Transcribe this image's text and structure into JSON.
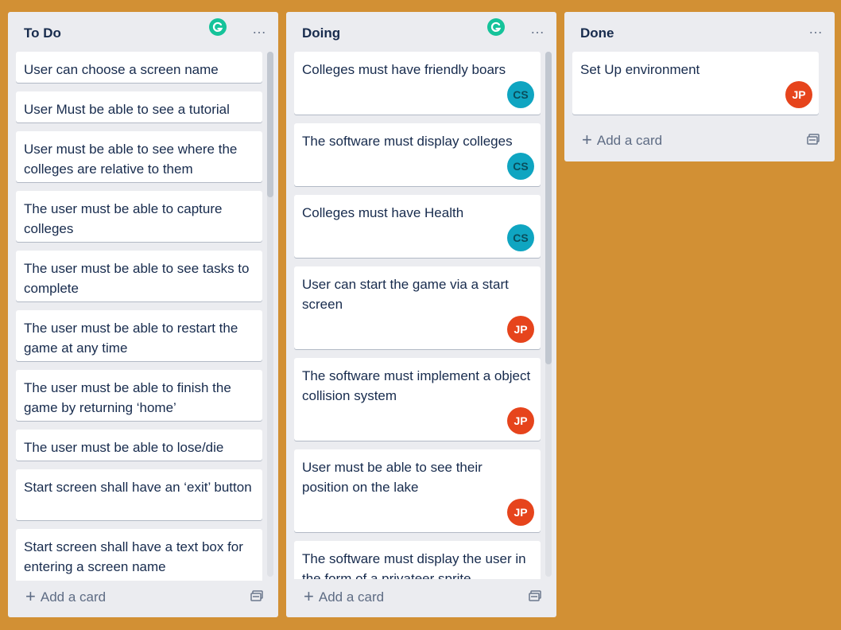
{
  "lists": [
    {
      "title": "To Do",
      "menu": "…",
      "add_card": "Add a card",
      "cards": [
        {
          "text": "User can choose a screen name"
        },
        {
          "text": "User Must be able to see a tutorial"
        },
        {
          "text": "User must be able to see where the colleges are relative to them"
        },
        {
          "text": "The user must be able to capture colleges"
        },
        {
          "text": "The user must be able to see tasks to complete"
        },
        {
          "text": "The user must be able to restart the game at any time"
        },
        {
          "text": "The user must be able to finish the game by returning ‘home’"
        },
        {
          "text": "The user must be able to lose/die"
        },
        {
          "text": "Start screen shall have an ‘exit’ button"
        },
        {
          "text": "Start screen shall have a text box for entering a screen name"
        }
      ]
    },
    {
      "title": "Doing",
      "menu": "…",
      "add_card": "Add a card",
      "cards": [
        {
          "text": "Colleges must have friendly boars",
          "avatar": "CS"
        },
        {
          "text": "The software must display colleges",
          "avatar": "CS"
        },
        {
          "text": "Colleges must have Health",
          "avatar": "CS"
        },
        {
          "text": "User can start the game via a start screen",
          "avatar": "JP"
        },
        {
          "text": "The software must implement a object collision system",
          "avatar": "JP"
        },
        {
          "text": "User must be able to see their position on the lake",
          "avatar": "JP"
        },
        {
          "text": "The software must display the user in the form of a privateer sprite"
        }
      ]
    },
    {
      "title": "Done",
      "menu": "…",
      "add_card": "Add a card",
      "cards": [
        {
          "text": "Set Up environment",
          "avatar": "JP"
        }
      ]
    }
  ],
  "colors": {
    "board_background": "#d29034",
    "list_background": "#ebecf0",
    "avatar_cs": "#0fa5c1",
    "avatar_jp": "#e6441c",
    "grammarly": "#15c39a"
  },
  "icons": [
    "grammarly-icon",
    "more-options-icon",
    "plus-icon",
    "card-template-icon"
  ]
}
